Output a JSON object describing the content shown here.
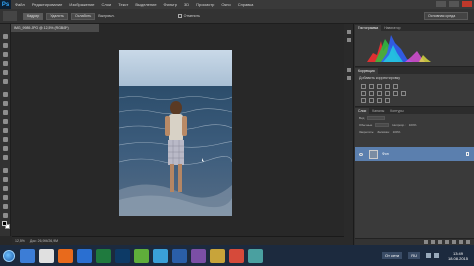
{
  "app": {
    "logo": "Ps",
    "menu": [
      "Файл",
      "Редактирование",
      "Изображение",
      "Слои",
      "Текст",
      "Выделение",
      "Фильтр",
      "3D",
      "Просмотр",
      "Окно",
      "Справка"
    ]
  },
  "options_bar": {
    "tool_icon": "move-tool-icon",
    "buttons": [
      "Кадрир",
      "Удалить",
      "Ослабить"
    ],
    "straighten_label": "Выпрямл.",
    "check_label": "Отменить",
    "workspace": "Основная среда"
  },
  "document": {
    "tab_title": "IMG_9989.JPG @ 12,5% (RGB/8*)",
    "zoom": "12,5%",
    "doc_size": "Док: 26,9М/26,9М"
  },
  "panels": {
    "histogram_tabs": [
      "Гистограмма",
      "Навигатор"
    ],
    "adjustments_tabs": [
      "Коррекция"
    ],
    "adjustments_title": "Добавить корректировку",
    "layers_tabs": [
      "Слои",
      "Каналы",
      "Контуры"
    ],
    "kind_label": "Вид",
    "mode_label": "Обычные",
    "opacity_label": "Непрозр.:",
    "opacity_value": "100%",
    "lock_label": "Закрепить:",
    "fill_label": "Заливка:",
    "fill_value": "100%",
    "layer_name": "Фон"
  },
  "taskbar": {
    "lang": "RU",
    "time": "13:49",
    "date": "18.08.2015",
    "show_desktop_label": "От сети"
  },
  "colors": {
    "menubar": "#3a3a3a",
    "canvas_bg": "#282828",
    "selected_layer": "#5b7fae",
    "taskbar": "#1c2a3e"
  }
}
